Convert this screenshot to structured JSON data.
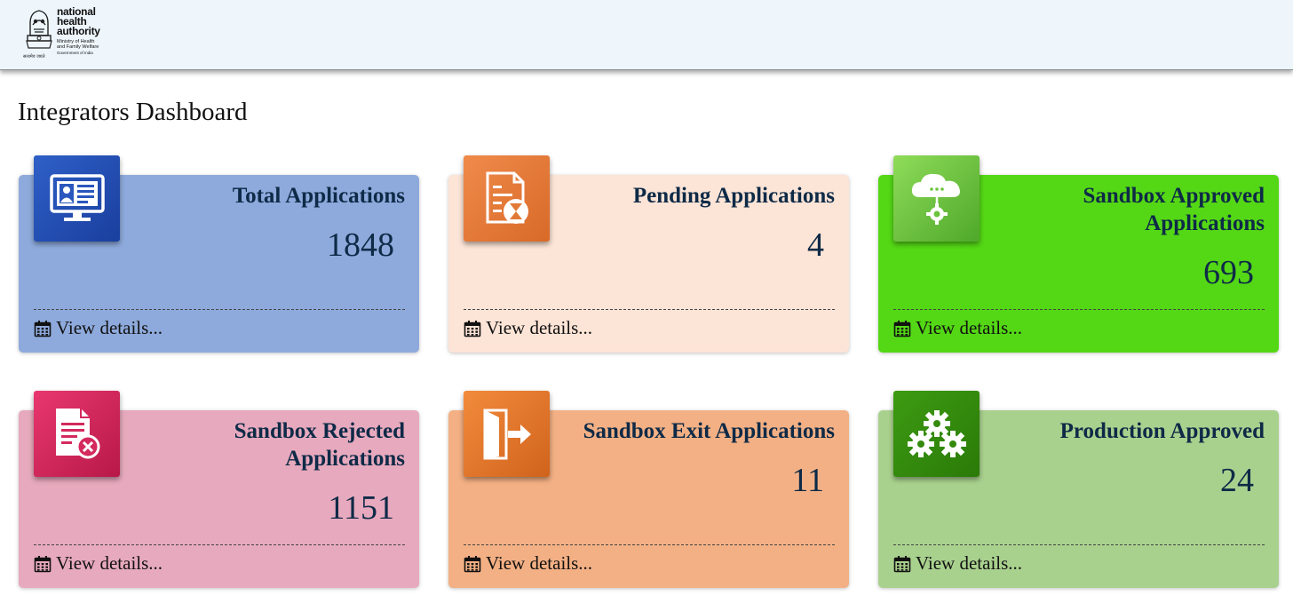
{
  "header": {
    "logo": {
      "line1": "national",
      "line2": "health",
      "line3": "authority",
      "ministry1": "Ministry of Health",
      "ministry2": "and Family Welfare",
      "government": "Government of India",
      "motto": "सत्यमेव जयते"
    }
  },
  "page": {
    "title": "Integrators Dashboard"
  },
  "cards": [
    {
      "id": "total",
      "title": "Total Applications",
      "value": "1848",
      "link": "View details...",
      "icon": "computer-user-icon"
    },
    {
      "id": "pending",
      "title": "Pending Applications",
      "value": "4",
      "link": "View details...",
      "icon": "document-hourglass-icon"
    },
    {
      "id": "sandbox-approved",
      "title": "Sandbox Approved Applications",
      "value": "693",
      "link": "View details...",
      "icon": "cloud-gear-icon"
    },
    {
      "id": "sandbox-rejected",
      "title": "Sandbox Rejected Applications",
      "value": "1151",
      "link": "View details...",
      "icon": "document-rejected-icon"
    },
    {
      "id": "sandbox-exit",
      "title": "Sandbox Exit Applications",
      "value": "11",
      "link": "View details...",
      "icon": "exit-door-icon"
    },
    {
      "id": "production-approved",
      "title": "Production Approved",
      "value": "24",
      "link": "View details...",
      "icon": "gears-icon"
    }
  ],
  "colors": {
    "header_bg": "#eef6fc",
    "total": "#8eaadc",
    "pending": "#fce4d6",
    "sandbox_approved": "#54d815",
    "sandbox_rejected": "#e7a9bd",
    "sandbox_exit": "#f3b084",
    "production_approved": "#a9d18e",
    "text": "#0e2a47"
  }
}
